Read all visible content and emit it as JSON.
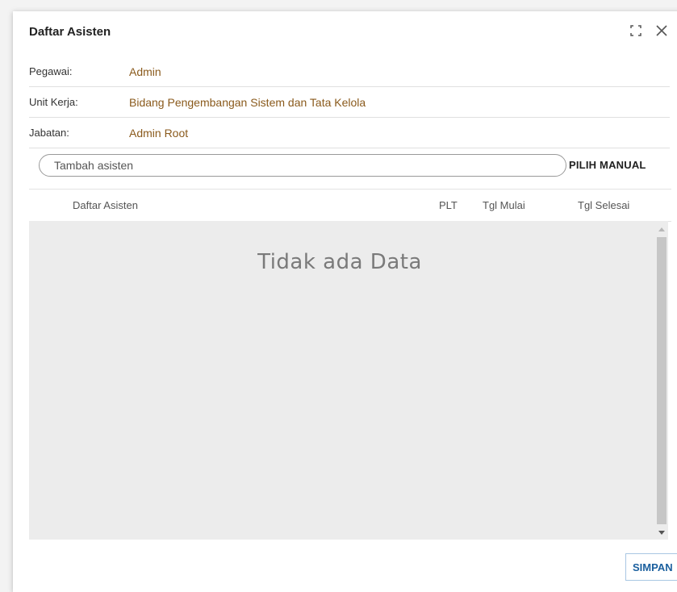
{
  "dialog": {
    "title": "Daftar Asisten",
    "icons": [
      "fullscreen-icon",
      "close-icon"
    ]
  },
  "info": {
    "pegawai_label": "Pegawai:",
    "pegawai_value": "Admin",
    "unit_label": "Unit Kerja:",
    "unit_value": "Bidang Pengembangan Sistem dan Tata Kelola",
    "jabatan_label": "Jabatan:",
    "jabatan_value": "Admin Root"
  },
  "search": {
    "placeholder": "Tambah asisten",
    "manual_button": "PILIH MANUAL"
  },
  "table": {
    "columns": [
      "Daftar Asisten",
      "PLT",
      "Tgl Mulai",
      "Tgl Selesai"
    ],
    "rows": [],
    "empty_message": "Tidak ada Data"
  },
  "footer": {
    "save_label": "SIMPAN"
  },
  "colors": {
    "value_text": "#8a5a1c",
    "primary_button": "#1a5f9e"
  }
}
